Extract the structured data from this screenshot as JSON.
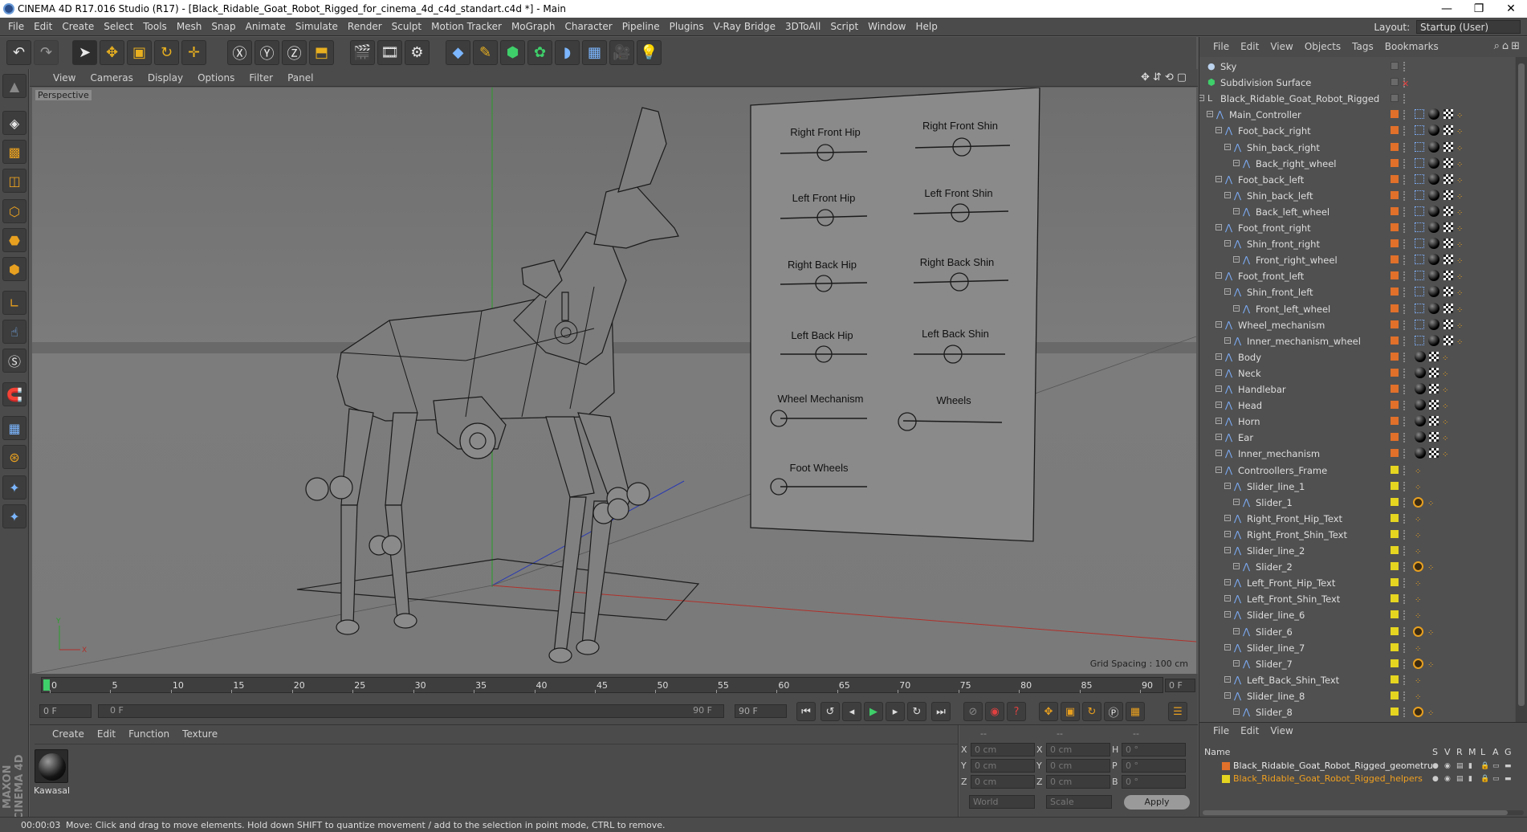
{
  "title": "CINEMA 4D R17.016 Studio (R17) - [Black_Ridable_Goat_Robot_Rigged_for_cinema_4d_c4d_standart.c4d *] - Main",
  "window_buttons": [
    "—",
    "❐",
    "✕"
  ],
  "menu": [
    "File",
    "Edit",
    "Create",
    "Select",
    "Tools",
    "Mesh",
    "Snap",
    "Animate",
    "Simulate",
    "Render",
    "Sculpt",
    "Motion Tracker",
    "MoGraph",
    "Character",
    "Pipeline",
    "Plugins",
    "V-Ray Bridge",
    "3DToAll",
    "Script",
    "Window",
    "Help"
  ],
  "layout": {
    "label": "Layout:",
    "value": "Startup (User)"
  },
  "viewport": {
    "menu": [
      "View",
      "Cameras",
      "Display",
      "Options",
      "Filter",
      "Panel"
    ],
    "camera": "Perspective",
    "grid_spacing": "Grid Spacing : 100 cm",
    "panel_labels": {
      "right_front_hip": "Right Front Hip",
      "right_front_shin": "Right Front Shin",
      "left_front_hip": "Left Front Hip",
      "left_front_shin": "Left Front Shin",
      "right_back_hip": "Right Back Hip",
      "right_back_shin": "Right Back Shin",
      "left_back_hip": "Left Back Hip",
      "left_back_shin": "Left Back Shin",
      "wheel_mechanism": "Wheel Mechanism",
      "wheels": "Wheels",
      "foot_wheels": "Foot Wheels"
    },
    "axis": {
      "y": "Y",
      "x": "X"
    }
  },
  "timeline": {
    "ticks": [
      "0",
      "5",
      "10",
      "15",
      "20",
      "25",
      "30",
      "35",
      "40",
      "45",
      "50",
      "55",
      "60",
      "65",
      "70",
      "75",
      "80",
      "85",
      "90"
    ],
    "current_frame": "0 F"
  },
  "transport": {
    "start": "0 F",
    "range_start": "0 F",
    "range_end": "90 F",
    "end": "90 F"
  },
  "material_manager": {
    "menu": [
      "Create",
      "Edit",
      "Function",
      "Texture"
    ],
    "material_name": "Kawasal"
  },
  "coordinates": {
    "top_labels": [
      "--",
      "--",
      "--"
    ],
    "rows": [
      {
        "a": "X",
        "av": "0 cm",
        "b": "X",
        "bv": "0 cm",
        "c": "H",
        "cv": "0 °"
      },
      {
        "a": "Y",
        "av": "0 cm",
        "b": "Y",
        "bv": "0 cm",
        "c": "P",
        "cv": "0 °"
      },
      {
        "a": "Z",
        "av": "0 cm",
        "b": "Z",
        "bv": "0 cm",
        "c": "B",
        "cv": "0 °"
      }
    ],
    "world": "World",
    "scale": "Scale",
    "apply": "Apply"
  },
  "status": {
    "time": "00:00:03",
    "message": "Move: Click and drag to move elements. Hold down SHIFT to quantize movement / add to the selection in point mode, CTRL to remove."
  },
  "object_manager": {
    "menu": [
      "File",
      "Edit",
      "View",
      "Objects",
      "Tags",
      "Bookmarks"
    ],
    "objects": [
      {
        "name": "Sky",
        "indent": 0,
        "color": "",
        "icon": "sky"
      },
      {
        "name": "Subdivision Surface",
        "indent": 0,
        "color": "",
        "icon": "subdiv"
      },
      {
        "name": "Black_Ridable_Goat_Robot_Rigged",
        "indent": 0,
        "color": "",
        "icon": "null"
      },
      {
        "name": "Main_Controller",
        "indent": 1,
        "color": "#e0702a",
        "icon": "joint"
      },
      {
        "name": "Foot_back_right",
        "indent": 2,
        "color": "#e0702a",
        "icon": "joint"
      },
      {
        "name": "Shin_back_right",
        "indent": 3,
        "color": "#e0702a",
        "icon": "joint"
      },
      {
        "name": "Back_right_wheel",
        "indent": 4,
        "color": "#e0702a",
        "icon": "joint"
      },
      {
        "name": "Foot_back_left",
        "indent": 2,
        "color": "#e0702a",
        "icon": "joint"
      },
      {
        "name": "Shin_back_left",
        "indent": 3,
        "color": "#e0702a",
        "icon": "joint"
      },
      {
        "name": "Back_left_wheel",
        "indent": 4,
        "color": "#e0702a",
        "icon": "joint"
      },
      {
        "name": "Foot_front_right",
        "indent": 2,
        "color": "#e0702a",
        "icon": "joint"
      },
      {
        "name": "Shin_front_right",
        "indent": 3,
        "color": "#e0702a",
        "icon": "joint"
      },
      {
        "name": "Front_right_wheel",
        "indent": 4,
        "color": "#e0702a",
        "icon": "joint"
      },
      {
        "name": "Foot_front_left",
        "indent": 2,
        "color": "#e0702a",
        "icon": "joint"
      },
      {
        "name": "Shin_front_left",
        "indent": 3,
        "color": "#e0702a",
        "icon": "joint"
      },
      {
        "name": "Front_left_wheel",
        "indent": 4,
        "color": "#e0702a",
        "icon": "joint"
      },
      {
        "name": "Wheel_mechanism",
        "indent": 2,
        "color": "#e0702a",
        "icon": "joint"
      },
      {
        "name": "Inner_mechanism_wheel",
        "indent": 3,
        "color": "#e0702a",
        "icon": "joint"
      },
      {
        "name": "Body",
        "indent": 2,
        "color": "#e0702a",
        "icon": "joint"
      },
      {
        "name": "Neck",
        "indent": 2,
        "color": "#e0702a",
        "icon": "joint"
      },
      {
        "name": "Handlebar",
        "indent": 2,
        "color": "#e0702a",
        "icon": "joint"
      },
      {
        "name": "Head",
        "indent": 2,
        "color": "#e0702a",
        "icon": "joint"
      },
      {
        "name": "Horn",
        "indent": 2,
        "color": "#e0702a",
        "icon": "joint"
      },
      {
        "name": "Ear",
        "indent": 2,
        "color": "#e0702a",
        "icon": "joint"
      },
      {
        "name": "Inner_mechanism",
        "indent": 2,
        "color": "#e0702a",
        "icon": "joint"
      },
      {
        "name": "Controollers_Frame",
        "indent": 2,
        "color": "#e5d520",
        "icon": "joint"
      },
      {
        "name": "Slider_line_1",
        "indent": 3,
        "color": "#e5d520",
        "icon": "joint"
      },
      {
        "name": "Slider_1",
        "indent": 4,
        "color": "#e5d520",
        "icon": "joint"
      },
      {
        "name": "Right_Front_Hip_Text",
        "indent": 3,
        "color": "#e5d520",
        "icon": "joint"
      },
      {
        "name": "Right_Front_Shin_Text",
        "indent": 3,
        "color": "#e5d520",
        "icon": "joint"
      },
      {
        "name": "Slider_line_2",
        "indent": 3,
        "color": "#e5d520",
        "icon": "joint"
      },
      {
        "name": "Slider_2",
        "indent": 4,
        "color": "#e5d520",
        "icon": "joint"
      },
      {
        "name": "Left_Front_Hip_Text",
        "indent": 3,
        "color": "#e5d520",
        "icon": "joint"
      },
      {
        "name": "Left_Front_Shin_Text",
        "indent": 3,
        "color": "#e5d520",
        "icon": "joint"
      },
      {
        "name": "Slider_line_6",
        "indent": 3,
        "color": "#e5d520",
        "icon": "joint"
      },
      {
        "name": "Slider_6",
        "indent": 4,
        "color": "#e5d520",
        "icon": "joint"
      },
      {
        "name": "Slider_line_7",
        "indent": 3,
        "color": "#e5d520",
        "icon": "joint"
      },
      {
        "name": "Slider_7",
        "indent": 4,
        "color": "#e5d520",
        "icon": "joint"
      },
      {
        "name": "Left_Back_Shin_Text",
        "indent": 3,
        "color": "#e5d520",
        "icon": "joint"
      },
      {
        "name": "Slider_line_8",
        "indent": 3,
        "color": "#e5d520",
        "icon": "joint"
      },
      {
        "name": "Slider_8",
        "indent": 4,
        "color": "#e5d520",
        "icon": "joint"
      }
    ]
  },
  "layer_manager": {
    "menu": [
      "File",
      "Edit",
      "View"
    ],
    "header": {
      "name": "Name",
      "cols": [
        "S",
        "V",
        "R",
        "M",
        "L",
        "A",
        "G"
      ]
    },
    "layers": [
      {
        "name": "Black_Ridable_Goat_Robot_Rigged_geometru",
        "color": "#e0702a",
        "text_color": "#e8e8e8"
      },
      {
        "name": "Black_Ridable_Goat_Robot_Rigged_helpers",
        "color": "#e5d520",
        "text_color": "#f0a020"
      }
    ]
  },
  "brand": "MAXON CINEMA 4D"
}
